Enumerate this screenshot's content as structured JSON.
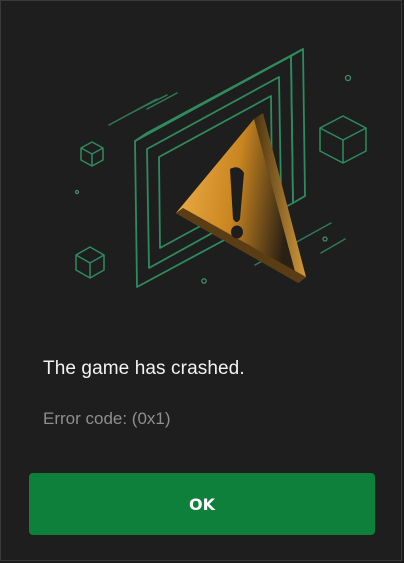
{
  "dialog": {
    "message": "The game has crashed.",
    "error_code": "Error code: (0x1)",
    "ok_label": "OK"
  },
  "colors": {
    "background": "#1e1e1f",
    "accent_green": "#0f7f3c",
    "line_green": "#2f8a5e",
    "warning_orange": "#e7a13a"
  },
  "icons": {
    "illustration": "crash-warning-illustration"
  }
}
